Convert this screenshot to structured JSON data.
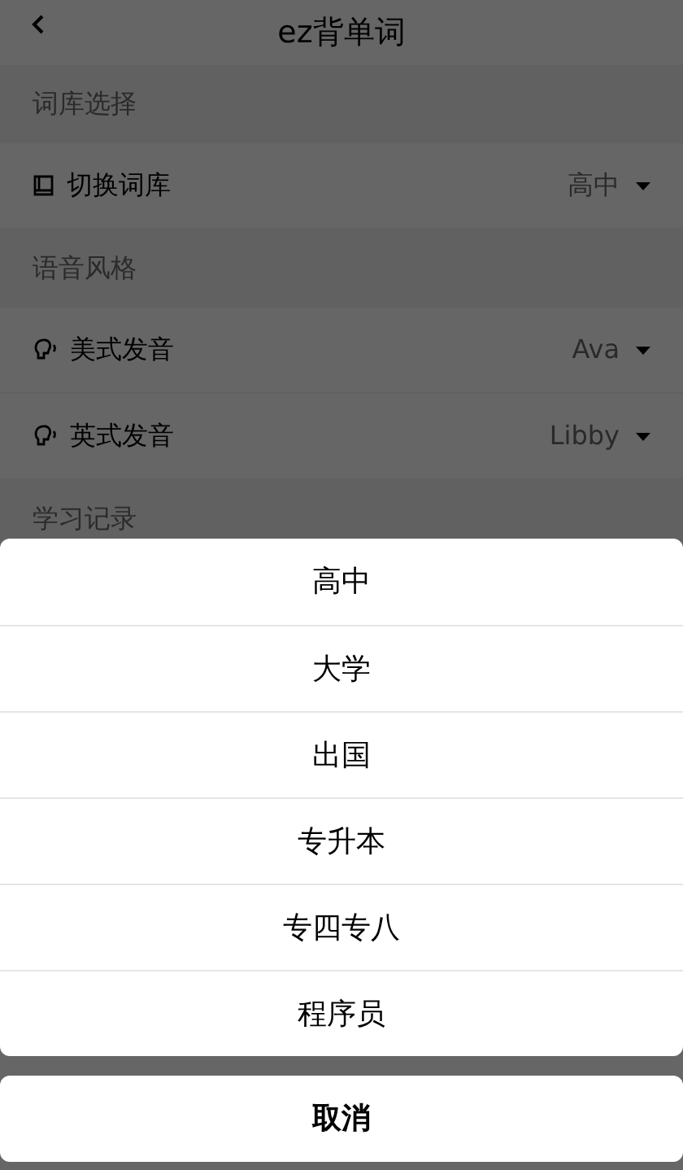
{
  "header": {
    "title": "ez背单词"
  },
  "sections": [
    {
      "title": "词库选择",
      "rows": [
        {
          "label": "切换词库",
          "value": "高中"
        }
      ]
    },
    {
      "title": "语音风格",
      "rows": [
        {
          "label": "美式发音",
          "value": "Ava"
        },
        {
          "label": "英式发音",
          "value": "Libby"
        }
      ]
    },
    {
      "title": "学习记录"
    }
  ],
  "action_sheet": {
    "options": [
      {
        "label": "高中"
      },
      {
        "label": "大学"
      },
      {
        "label": "出国"
      },
      {
        "label": "专升本"
      },
      {
        "label": "专四专八"
      },
      {
        "label": "程序员"
      }
    ],
    "cancel": "取消"
  }
}
